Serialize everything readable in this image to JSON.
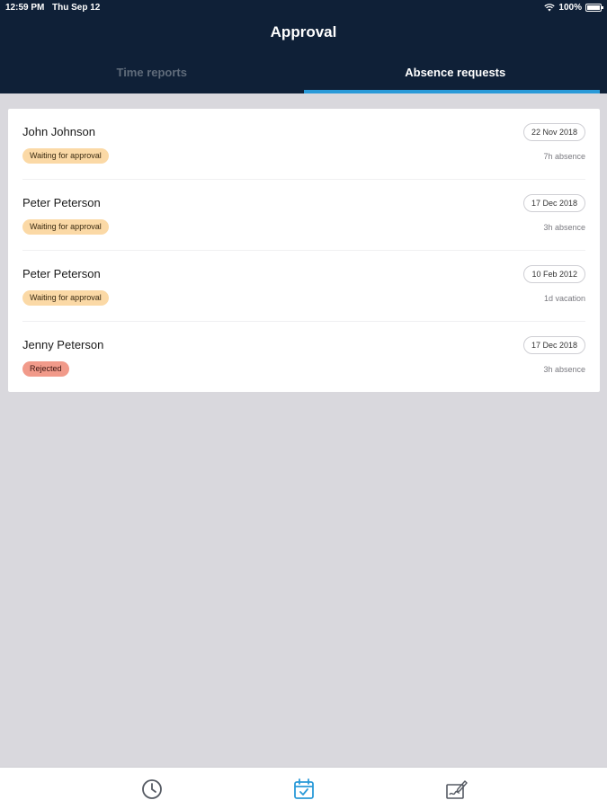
{
  "status_bar": {
    "time": "12:59 PM",
    "date": "Thu Sep 12",
    "battery": "100%",
    "wifi_icon": "wifi-icon",
    "battery_icon": "battery-icon"
  },
  "header": {
    "title": "Approval"
  },
  "tabs": [
    {
      "label": "Time reports",
      "active": false
    },
    {
      "label": "Absence requests",
      "active": true
    }
  ],
  "requests": [
    {
      "name": "John Johnson",
      "status": "Waiting for approval",
      "date": "22 Nov 2018",
      "duration": "7h absence"
    },
    {
      "name": "Peter Peterson",
      "status": "Waiting for approval",
      "date": "17 Dec 2018",
      "duration": "3h absence"
    },
    {
      "name": "Peter Peterson",
      "status": "Waiting for approval",
      "date": "10 Feb 2012",
      "duration": "1d vacation"
    },
    {
      "name": "Jenny Peterson",
      "status": "Rejected",
      "date": "17 Dec 2018",
      "duration": "3h absence"
    }
  ],
  "bottom_nav": [
    {
      "icon": "clock-icon",
      "active": false
    },
    {
      "icon": "calendar-check-icon",
      "active": true
    },
    {
      "icon": "signature-icon",
      "active": false
    }
  ],
  "colors": {
    "header_bg": "#0f2037",
    "accent": "#2a9ad8",
    "waiting_badge": "#fbd9a6",
    "rejected_badge": "#f19a8a",
    "page_bg": "#d9d8dd"
  }
}
